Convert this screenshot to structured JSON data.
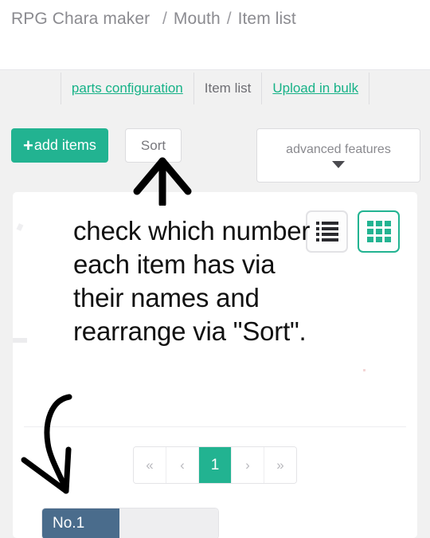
{
  "breadcrumb": {
    "root": "RPG Chara maker",
    "faded": "\u0019     ",
    "sep": "/",
    "section": "Mouth",
    "page": "Item list"
  },
  "tabs": [
    {
      "label": "parts configuration",
      "active": false
    },
    {
      "label": "Item list",
      "active": true
    },
    {
      "label": "Upload in bulk",
      "active": false
    }
  ],
  "toolbar": {
    "add_plus": "+",
    "add_label": "add items",
    "sort_label": "Sort",
    "advanced_label": "advanced features",
    "advanced_icon": "chevron-down-icon"
  },
  "view_toggle": {
    "list_icon": "list-view-icon",
    "grid_icon": "grid-view-icon",
    "active": "grid"
  },
  "annotation": {
    "text": "check which number each item has via their names and rearrange via \"Sort\".",
    "arrow_up_target": "sort-button",
    "arrow_curve_target": "item-card-no1"
  },
  "pagination": {
    "first": "«",
    "prev": "‹",
    "current": "1",
    "next": "›",
    "last": "»"
  },
  "items": [
    {
      "no_label": "No.1"
    }
  ],
  "colors": {
    "accent_green": "#22b391",
    "tab_link": "#16b287",
    "item_badge": "#4a6c8c",
    "page_bg": "#f1f1f1",
    "card_bg": "#ffffff"
  }
}
